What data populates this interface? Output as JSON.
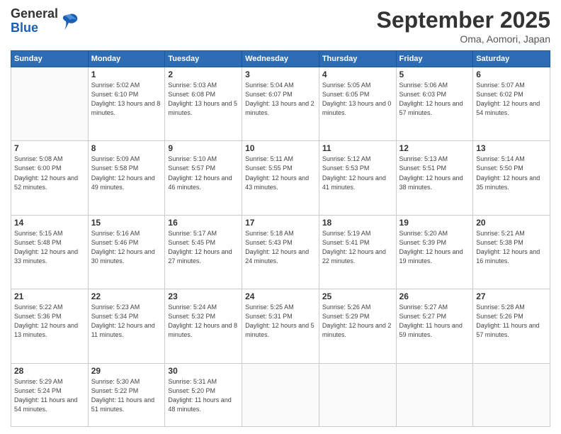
{
  "header": {
    "logo": {
      "general": "General",
      "blue": "Blue"
    },
    "title": "September 2025",
    "location": "Oma, Aomori, Japan"
  },
  "weekdays": [
    "Sunday",
    "Monday",
    "Tuesday",
    "Wednesday",
    "Thursday",
    "Friday",
    "Saturday"
  ],
  "weeks": [
    [
      null,
      {
        "day": 1,
        "sunrise": "5:02 AM",
        "sunset": "6:10 PM",
        "daylight": "13 hours and 8 minutes."
      },
      {
        "day": 2,
        "sunrise": "5:03 AM",
        "sunset": "6:08 PM",
        "daylight": "13 hours and 5 minutes."
      },
      {
        "day": 3,
        "sunrise": "5:04 AM",
        "sunset": "6:07 PM",
        "daylight": "13 hours and 2 minutes."
      },
      {
        "day": 4,
        "sunrise": "5:05 AM",
        "sunset": "6:05 PM",
        "daylight": "13 hours and 0 minutes."
      },
      {
        "day": 5,
        "sunrise": "5:06 AM",
        "sunset": "6:03 PM",
        "daylight": "12 hours and 57 minutes."
      },
      {
        "day": 6,
        "sunrise": "5:07 AM",
        "sunset": "6:02 PM",
        "daylight": "12 hours and 54 minutes."
      }
    ],
    [
      {
        "day": 7,
        "sunrise": "5:08 AM",
        "sunset": "6:00 PM",
        "daylight": "12 hours and 52 minutes."
      },
      {
        "day": 8,
        "sunrise": "5:09 AM",
        "sunset": "5:58 PM",
        "daylight": "12 hours and 49 minutes."
      },
      {
        "day": 9,
        "sunrise": "5:10 AM",
        "sunset": "5:57 PM",
        "daylight": "12 hours and 46 minutes."
      },
      {
        "day": 10,
        "sunrise": "5:11 AM",
        "sunset": "5:55 PM",
        "daylight": "12 hours and 43 minutes."
      },
      {
        "day": 11,
        "sunrise": "5:12 AM",
        "sunset": "5:53 PM",
        "daylight": "12 hours and 41 minutes."
      },
      {
        "day": 12,
        "sunrise": "5:13 AM",
        "sunset": "5:51 PM",
        "daylight": "12 hours and 38 minutes."
      },
      {
        "day": 13,
        "sunrise": "5:14 AM",
        "sunset": "5:50 PM",
        "daylight": "12 hours and 35 minutes."
      }
    ],
    [
      {
        "day": 14,
        "sunrise": "5:15 AM",
        "sunset": "5:48 PM",
        "daylight": "12 hours and 33 minutes."
      },
      {
        "day": 15,
        "sunrise": "5:16 AM",
        "sunset": "5:46 PM",
        "daylight": "12 hours and 30 minutes."
      },
      {
        "day": 16,
        "sunrise": "5:17 AM",
        "sunset": "5:45 PM",
        "daylight": "12 hours and 27 minutes."
      },
      {
        "day": 17,
        "sunrise": "5:18 AM",
        "sunset": "5:43 PM",
        "daylight": "12 hours and 24 minutes."
      },
      {
        "day": 18,
        "sunrise": "5:19 AM",
        "sunset": "5:41 PM",
        "daylight": "12 hours and 22 minutes."
      },
      {
        "day": 19,
        "sunrise": "5:20 AM",
        "sunset": "5:39 PM",
        "daylight": "12 hours and 19 minutes."
      },
      {
        "day": 20,
        "sunrise": "5:21 AM",
        "sunset": "5:38 PM",
        "daylight": "12 hours and 16 minutes."
      }
    ],
    [
      {
        "day": 21,
        "sunrise": "5:22 AM",
        "sunset": "5:36 PM",
        "daylight": "12 hours and 13 minutes."
      },
      {
        "day": 22,
        "sunrise": "5:23 AM",
        "sunset": "5:34 PM",
        "daylight": "12 hours and 11 minutes."
      },
      {
        "day": 23,
        "sunrise": "5:24 AM",
        "sunset": "5:32 PM",
        "daylight": "12 hours and 8 minutes."
      },
      {
        "day": 24,
        "sunrise": "5:25 AM",
        "sunset": "5:31 PM",
        "daylight": "12 hours and 5 minutes."
      },
      {
        "day": 25,
        "sunrise": "5:26 AM",
        "sunset": "5:29 PM",
        "daylight": "12 hours and 2 minutes."
      },
      {
        "day": 26,
        "sunrise": "5:27 AM",
        "sunset": "5:27 PM",
        "daylight": "11 hours and 59 minutes."
      },
      {
        "day": 27,
        "sunrise": "5:28 AM",
        "sunset": "5:26 PM",
        "daylight": "11 hours and 57 minutes."
      }
    ],
    [
      {
        "day": 28,
        "sunrise": "5:29 AM",
        "sunset": "5:24 PM",
        "daylight": "11 hours and 54 minutes."
      },
      {
        "day": 29,
        "sunrise": "5:30 AM",
        "sunset": "5:22 PM",
        "daylight": "11 hours and 51 minutes."
      },
      {
        "day": 30,
        "sunrise": "5:31 AM",
        "sunset": "5:20 PM",
        "daylight": "11 hours and 48 minutes."
      },
      null,
      null,
      null,
      null
    ]
  ],
  "labels": {
    "sunrise": "Sunrise:",
    "sunset": "Sunset:",
    "daylight": "Daylight:"
  }
}
